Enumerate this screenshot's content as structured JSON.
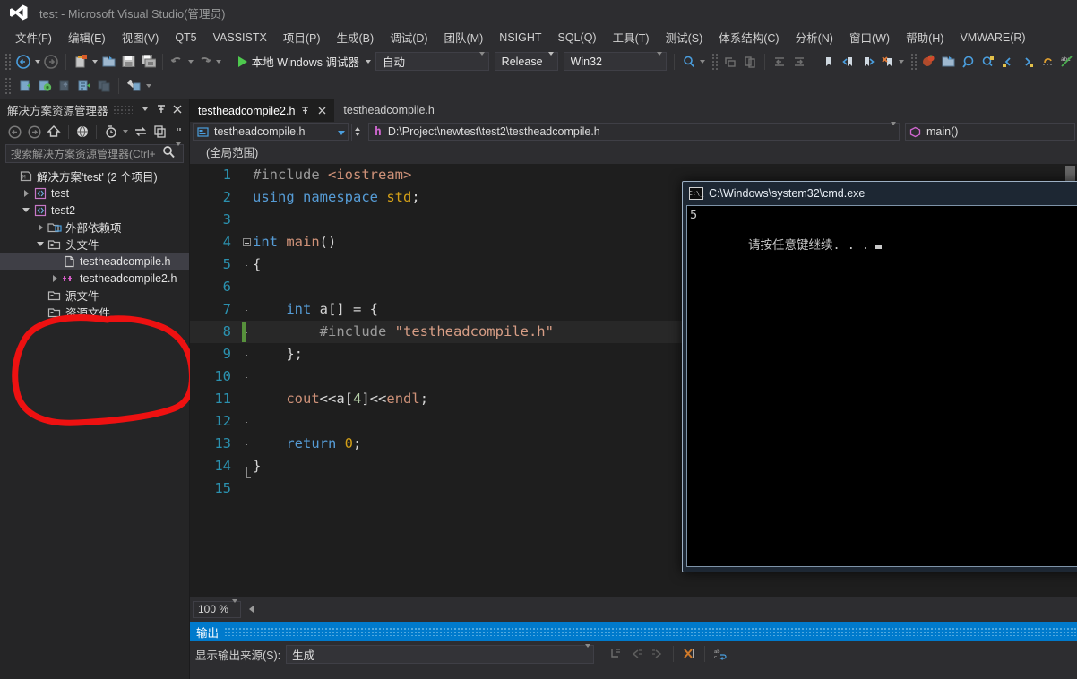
{
  "window": {
    "title": "test - Microsoft Visual Studio(管理员)",
    "logo_icon": "visual-studio-logo-icon"
  },
  "menubar": {
    "items": [
      {
        "label": "文件(F)"
      },
      {
        "label": "编辑(E)"
      },
      {
        "label": "视图(V)"
      },
      {
        "label": "QT5"
      },
      {
        "label": "VASSISTX"
      },
      {
        "label": "项目(P)"
      },
      {
        "label": "生成(B)"
      },
      {
        "label": "调试(D)"
      },
      {
        "label": "团队(M)"
      },
      {
        "label": "NSIGHT"
      },
      {
        "label": "SQL(Q)"
      },
      {
        "label": "工具(T)"
      },
      {
        "label": "测试(S)"
      },
      {
        "label": "体系结构(C)"
      },
      {
        "label": "分析(N)"
      },
      {
        "label": "窗口(W)"
      },
      {
        "label": "帮助(H)"
      },
      {
        "label": "VMWARE(R)"
      }
    ]
  },
  "toolbar": {
    "start_debug_label": "本地 Windows 调试器",
    "platform_toolset": "自动",
    "configuration": "Release",
    "platform": "Win32",
    "icons_row1": [
      "navigate-back-icon",
      "navigate-forward-icon",
      "new-project-icon",
      "open-file-icon",
      "save-icon",
      "save-all-icon",
      "undo-icon",
      "redo-icon"
    ],
    "icons_row2": [
      "step-into-icon",
      "attach-debugger-icon",
      "step-over-icon",
      "step-out-icon",
      "stop-icon",
      "toolbox-icon"
    ],
    "icons_right": [
      "find-icon",
      "comment-icon",
      "uncomment-icon",
      "decrease-indent-icon",
      "increase-indent-icon",
      "toggle-bookmark-icon",
      "prev-bookmark-icon",
      "next-bookmark-icon",
      "clear-bookmarks-icon",
      "breakpoint-icon",
      "open-folder-icon",
      "zoom-icon",
      "quickfind-icon",
      "goto-prev-icon",
      "goto-next-icon",
      "undo-nav-icon",
      "spellcheck-icon"
    ]
  },
  "solution_explorer": {
    "title": "解决方案资源管理器",
    "header_icons": [
      "dropdown-icon",
      "pin-icon",
      "close-icon"
    ],
    "toolbar_icons": [
      "back-icon",
      "forward-icon",
      "home-icon",
      "web-view-icon",
      "pending-changes-icon",
      "sync-icon",
      "collapse-all-icon",
      "overflow-icon"
    ],
    "search_placeholder": "搜索解决方案资源管理器(Ctrl+",
    "search_icon": "search-icon",
    "tree": [
      {
        "label": "解决方案'test' (2 个项目)",
        "icon": "solution-icon",
        "indent": 0,
        "twist": "none",
        "selected": false
      },
      {
        "label": "test",
        "icon": "cpp-project-icon",
        "indent": 1,
        "twist": "collapsed",
        "selected": false
      },
      {
        "label": "test2",
        "icon": "cpp-project-icon",
        "indent": 1,
        "twist": "expanded",
        "selected": false
      },
      {
        "label": "外部依赖项",
        "icon": "external-deps-icon",
        "indent": 2,
        "twist": "collapsed",
        "selected": false
      },
      {
        "label": "头文件",
        "icon": "folder-filter-icon",
        "indent": 2,
        "twist": "expanded",
        "selected": false
      },
      {
        "label": "testheadcompile.h",
        "icon": "header-file-icon",
        "indent": 3,
        "twist": "none",
        "selected": true
      },
      {
        "label": "testheadcompile2.h",
        "icon": "cpp-header-icon",
        "indent": 3,
        "twist": "collapsed",
        "selected": false
      },
      {
        "label": "源文件",
        "icon": "folder-filter-icon",
        "indent": 2,
        "twist": "none",
        "selected": false
      },
      {
        "label": "资源文件",
        "icon": "folder-filter-icon",
        "indent": 2,
        "twist": "none",
        "selected": false
      }
    ],
    "annotation": {
      "shape": "hand-drawn-ellipse",
      "color": "#ee1111"
    }
  },
  "editor": {
    "tabs": [
      {
        "label": "testheadcompile2.h",
        "active": true,
        "has_pin": true,
        "has_close": true
      },
      {
        "label": "testheadcompile.h",
        "active": false,
        "has_pin": false,
        "has_close": false
      }
    ],
    "nav_project": "testheadcompile.h",
    "file_path": "D:\\Project\\newtest\\test2\\testheadcompile.h",
    "file_path_icon": "h-file-icon",
    "scope": "(全局范围)",
    "member": "main()",
    "member_icon": "method-icon",
    "zoom_level": "100 %",
    "current_line": 8,
    "lines": [
      {
        "num": "1",
        "tokens": [
          {
            "t": "#include ",
            "c": "pp"
          },
          {
            "t": "<iostream>",
            "c": "or"
          }
        ]
      },
      {
        "num": "2",
        "tokens": [
          {
            "t": "using namespace ",
            "c": "k"
          },
          {
            "t": "std",
            "c": "ty"
          },
          {
            "t": ";",
            "c": "pl"
          }
        ]
      },
      {
        "num": "3",
        "tokens": []
      },
      {
        "num": "4",
        "tokens": [
          {
            "t": "int ",
            "c": "k"
          },
          {
            "t": "main",
            "c": "or"
          },
          {
            "t": "()",
            "c": "pl"
          }
        ]
      },
      {
        "num": "5",
        "tokens": [
          {
            "t": "{",
            "c": "pl"
          }
        ]
      },
      {
        "num": "6",
        "tokens": []
      },
      {
        "num": "7",
        "tokens": [
          {
            "t": "    ",
            "c": "pl"
          },
          {
            "t": "int ",
            "c": "k"
          },
          {
            "t": "a[] = {",
            "c": "pl"
          }
        ]
      },
      {
        "num": "8",
        "tokens": [
          {
            "t": "        ",
            "c": "pl"
          },
          {
            "t": "#include ",
            "c": "pp"
          },
          {
            "t": "\"testheadcompile.h\"",
            "c": "s"
          }
        ]
      },
      {
        "num": "9",
        "tokens": [
          {
            "t": "    };",
            "c": "pl"
          }
        ]
      },
      {
        "num": "10",
        "tokens": []
      },
      {
        "num": "11",
        "tokens": [
          {
            "t": "    ",
            "c": "pl"
          },
          {
            "t": "cout",
            "c": "or"
          },
          {
            "t": "<<",
            "c": "pl"
          },
          {
            "t": "a[",
            "c": "pl"
          },
          {
            "t": "4",
            "c": "n"
          },
          {
            "t": "]",
            "c": "pl"
          },
          {
            "t": "<<",
            "c": "pl"
          },
          {
            "t": "endl",
            "c": "or"
          },
          {
            "t": ";",
            "c": "pl"
          }
        ]
      },
      {
        "num": "12",
        "tokens": []
      },
      {
        "num": "13",
        "tokens": [
          {
            "t": "    ",
            "c": "pl"
          },
          {
            "t": "return ",
            "c": "k"
          },
          {
            "t": "0",
            "c": "ty"
          },
          {
            "t": ";",
            "c": "pl"
          }
        ]
      },
      {
        "num": "14",
        "tokens": [
          {
            "t": "}",
            "c": "pl"
          }
        ]
      },
      {
        "num": "15",
        "tokens": []
      }
    ]
  },
  "output_pane": {
    "title": "输出",
    "source_label": "显示输出来源(S):",
    "source_value": "生成",
    "toolbar_icons": [
      "goto-message-icon",
      "prev-message-icon",
      "next-message-icon",
      "clear-all-icon",
      "word-wrap-icon"
    ]
  },
  "console": {
    "title": "C:\\Windows\\system32\\cmd.exe",
    "icon": "cmd-icon",
    "lines": [
      "5",
      "请按任意键继续. . ."
    ],
    "cursor": "block-cursor"
  },
  "colors": {
    "accent": "#007acc",
    "chrome": "#2d2d30",
    "panel": "#252526",
    "editor_bg": "#1e1e1e",
    "annotation_red": "#ee1111"
  }
}
